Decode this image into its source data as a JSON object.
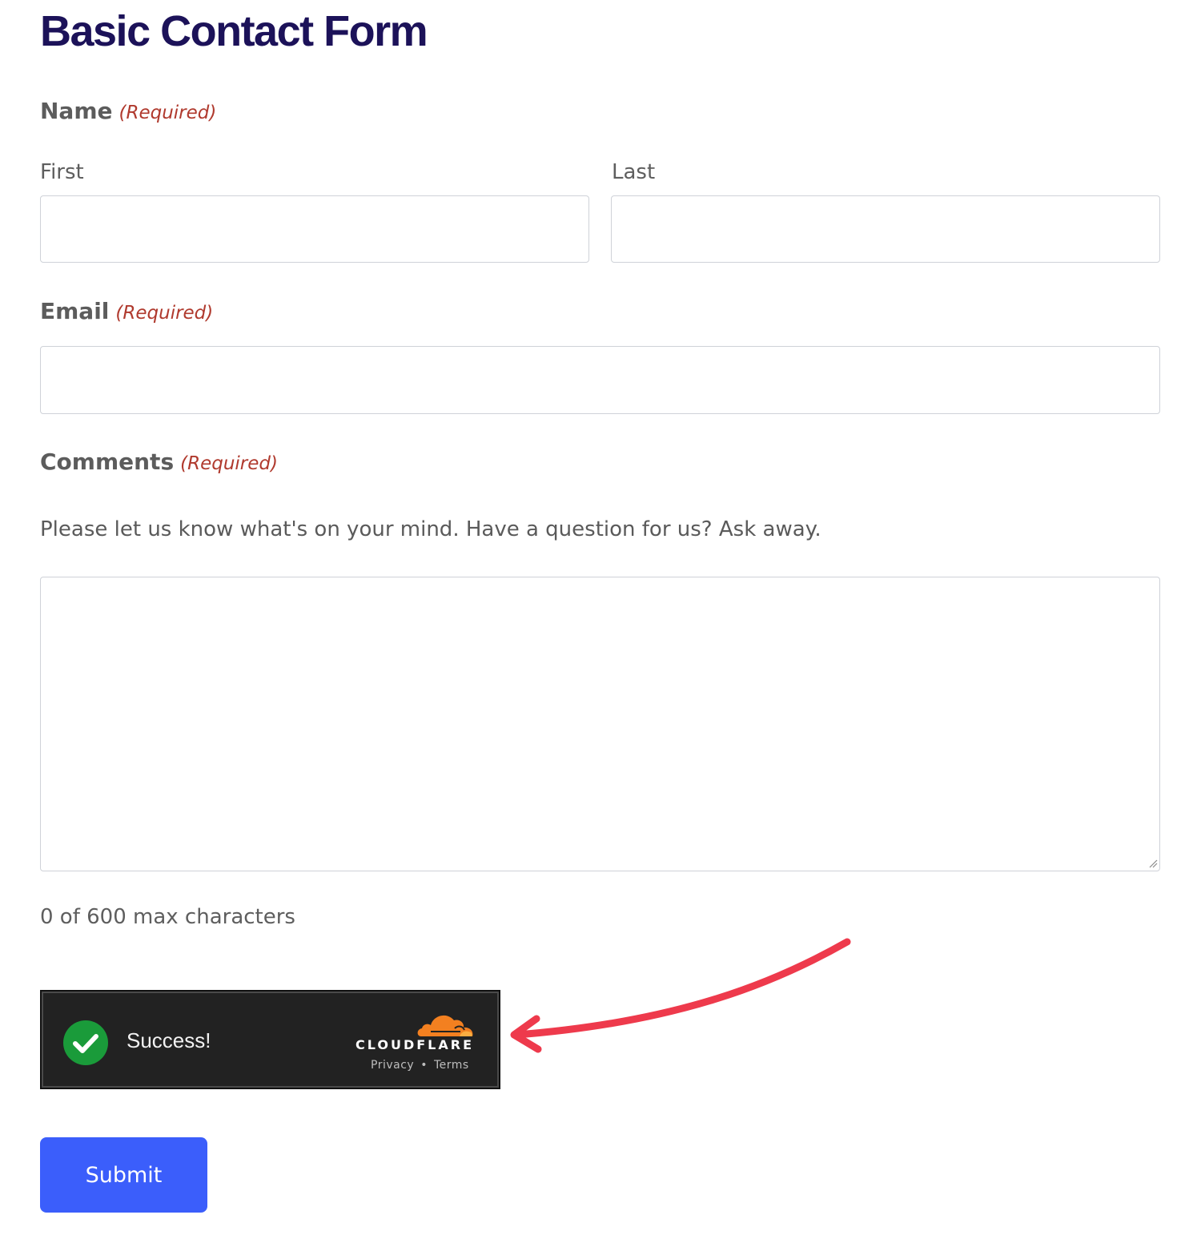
{
  "form": {
    "title": "Basic Contact Form",
    "required_marker": "(Required)",
    "name": {
      "label": "Name",
      "first_label": "First",
      "last_label": "Last",
      "first_value": "",
      "last_value": ""
    },
    "email": {
      "label": "Email",
      "value": ""
    },
    "comments": {
      "label": "Comments",
      "description": "Please let us know what's on your mind. Have a question for us? Ask away.",
      "value": "",
      "counter": "0 of 600 max characters"
    },
    "turnstile": {
      "status": "Success!",
      "brand": "CLOUDFLARE",
      "privacy_link": "Privacy",
      "separator": "•",
      "terms_link": "Terms",
      "brand_color": "#f38020",
      "success_color": "#1a9b3a"
    },
    "submit_label": "Submit"
  },
  "colors": {
    "title": "#1c1259",
    "required": "#b03a2e",
    "submit_button": "#3b5efb",
    "annotation_arrow": "#ee3a4c"
  },
  "icons": {
    "success": "check-circle-icon",
    "brand": "cloudflare-cloud-icon",
    "annotation": "curved-arrow-icon",
    "resize": "resize-grip-icon"
  }
}
